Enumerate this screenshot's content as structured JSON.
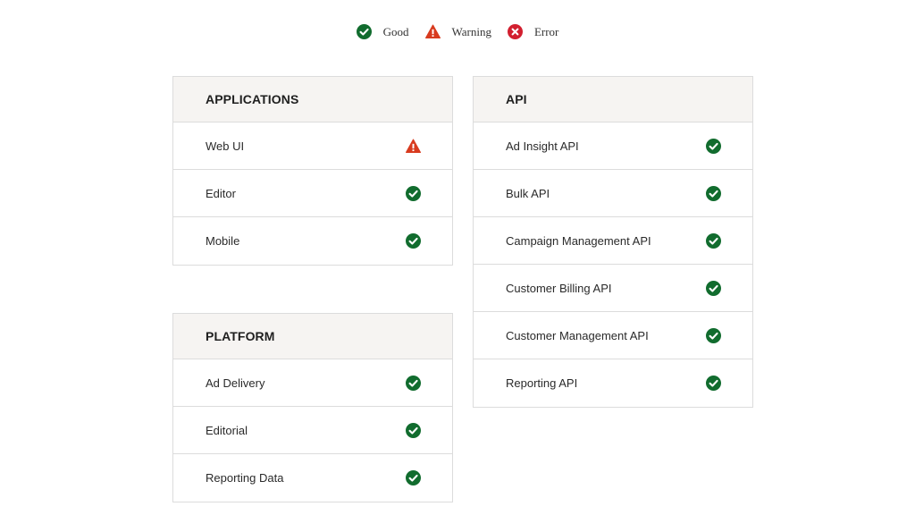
{
  "legend": [
    {
      "label": "Good",
      "icon": "check-circle-icon"
    },
    {
      "label": "Warning",
      "icon": "warning-triangle-icon"
    },
    {
      "label": "Error",
      "icon": "error-circle-icon"
    }
  ],
  "colors": {
    "good": "#116c2e",
    "warning": "#d83b1f",
    "error": "#d21f2f",
    "header_bg": "#f6f4f2",
    "border": "#dcdcdc"
  },
  "applications": {
    "title": "APPLICATIONS",
    "items": [
      {
        "label": "Web UI",
        "status": "warning"
      },
      {
        "label": "Editor",
        "status": "good"
      },
      {
        "label": "Mobile",
        "status": "good"
      }
    ]
  },
  "platform": {
    "title": "PLATFORM",
    "items": [
      {
        "label": "Ad Delivery",
        "status": "good"
      },
      {
        "label": "Editorial",
        "status": "good"
      },
      {
        "label": "Reporting Data",
        "status": "good"
      }
    ]
  },
  "api": {
    "title": "API",
    "items": [
      {
        "label": "Ad Insight API",
        "status": "good"
      },
      {
        "label": "Bulk API",
        "status": "good"
      },
      {
        "label": "Campaign Management API",
        "status": "good"
      },
      {
        "label": "Customer Billing API",
        "status": "good"
      },
      {
        "label": "Customer Management API",
        "status": "good"
      },
      {
        "label": "Reporting API",
        "status": "good"
      }
    ]
  }
}
